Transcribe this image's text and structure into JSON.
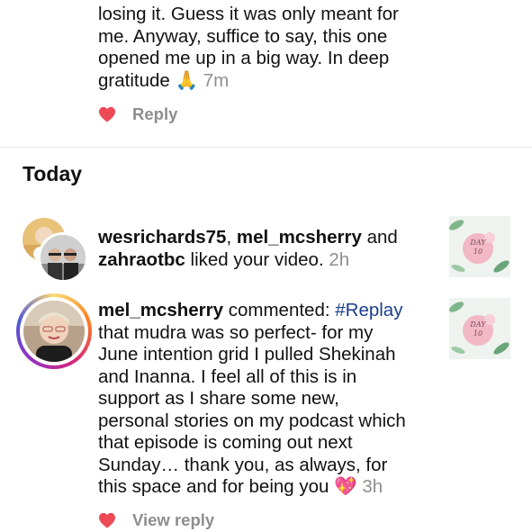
{
  "top_comment": {
    "lines": [
      "losing it. Guess it was only meant for",
      "me. Anyway, suffice to say, this one",
      "opened me up in a big way. In deep",
      "gratitude"
    ],
    "emoji": "🙏",
    "time": "7m",
    "reply_label": "Reply"
  },
  "section": {
    "title": "Today"
  },
  "notification_like": {
    "user1": "wesrichards75",
    "sep": ", ",
    "user2": "mel_mcsherry",
    "and": " and",
    "user3": "zahraotbc",
    "action": " liked your video.",
    "time": "2h",
    "thumb_text": "DAY 10"
  },
  "notification_comment": {
    "user": "mel_mcsherry",
    "action": " commented: ",
    "tag": "#Replay",
    "lines": [
      "that mudra was so perfect- for my",
      "June intention grid I pulled Shekinah",
      "and Inanna. I feel all of this is in",
      "support as I share some new,",
      "personal stories on my podcast which",
      "that episode is coming out next",
      "Sunday… thank you, as always, for",
      "this space and for being you"
    ],
    "emoji": "💖",
    "time": "3h",
    "view_reply_label": "View reply",
    "thumb_text": "DAY 10"
  },
  "colors": {
    "heart": "#ed4956",
    "hashtag": "#1b3d8f",
    "muted": "#8e8e8e",
    "story_ring": [
      "#feda75",
      "#fa7e1e",
      "#d62976",
      "#962fbf"
    ]
  }
}
